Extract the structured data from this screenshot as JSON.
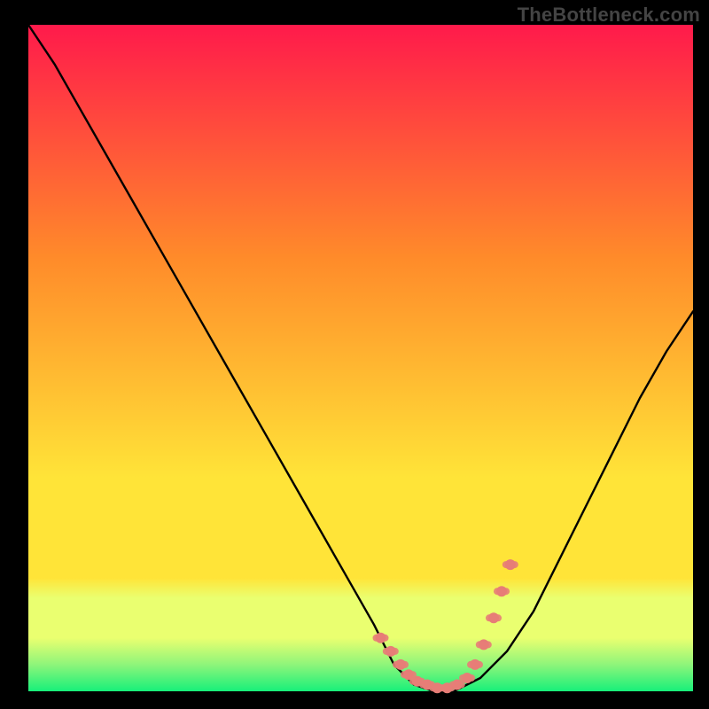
{
  "watermark": "TheBottleneck.com",
  "colors": {
    "background": "#000000",
    "gradient_top": "#ff1a4b",
    "gradient_mid1": "#ff8b2a",
    "gradient_mid2": "#ffe438",
    "gradient_band": "#eaff70",
    "gradient_bottom": "#17f07a",
    "curve": "#000000",
    "marker": "#e77d77"
  },
  "chart_data": {
    "type": "line",
    "title": "",
    "xlabel": "",
    "ylabel": "",
    "xlim": [
      0,
      100
    ],
    "ylim": [
      0,
      100
    ],
    "grid": false,
    "legend": false,
    "series": [
      {
        "name": "bottleneck-curve",
        "x": [
          0,
          4,
          8,
          12,
          16,
          20,
          24,
          28,
          32,
          36,
          40,
          44,
          48,
          52,
          55,
          58,
          61,
          64,
          68,
          72,
          76,
          80,
          84,
          88,
          92,
          96,
          100
        ],
        "y": [
          100,
          94,
          87,
          80,
          73,
          66,
          59,
          52,
          45,
          38,
          31,
          24,
          17,
          10,
          4,
          1,
          0,
          0,
          2,
          6,
          12,
          20,
          28,
          36,
          44,
          51,
          57
        ]
      }
    ],
    "markers": {
      "name": "highlight-dots",
      "x": [
        53,
        54.5,
        56,
        57.2,
        58.5,
        60,
        61.5,
        63,
        64.5,
        66,
        67.2,
        68.5,
        70,
        71.2,
        72.5
      ],
      "y": [
        8,
        6,
        4,
        2.5,
        1.5,
        1,
        0.5,
        0.5,
        1,
        2,
        4,
        7,
        11,
        15,
        19
      ]
    }
  }
}
